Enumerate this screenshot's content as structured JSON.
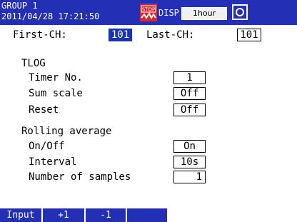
{
  "header": {
    "group": "GROUP 1",
    "datetime": "2011/04/28 17:21:50",
    "disp_label": "DISP",
    "span": "1hour"
  },
  "channels": {
    "first_label": "First-CH:",
    "first_value": "101",
    "last_label": "Last-CH:",
    "last_value": "101"
  },
  "tlog": {
    "title": "TLOG",
    "timer_label": "Timer No.",
    "timer_value": "1",
    "sum_label": "Sum scale",
    "sum_value": "Off",
    "reset_label": "Reset",
    "reset_value": "Off"
  },
  "rolling": {
    "title": "Rolling average",
    "onoff_label": "On/Off",
    "onoff_value": "On",
    "interval_label": "Interval",
    "interval_value": "10s",
    "samples_label": "Number of samples",
    "samples_value": "1"
  },
  "softkeys": [
    "Input",
    "+1",
    "-1"
  ],
  "colors": {
    "header_bg": "#2330b6",
    "selection": "#1a33b3",
    "stop_icon": "#e0262a"
  }
}
